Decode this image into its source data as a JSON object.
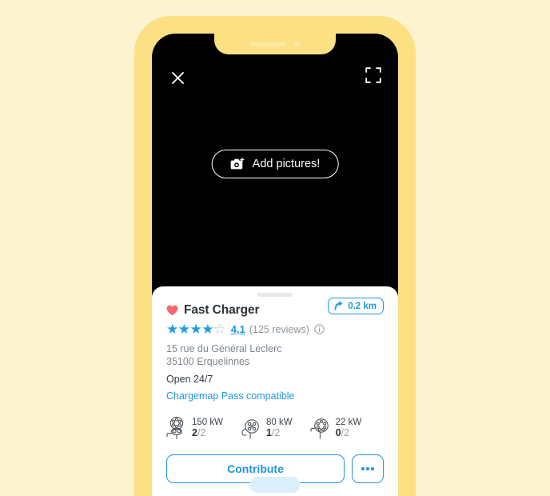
{
  "phone": {
    "notch": {
      "speaker_name": "earpiece-speaker",
      "camera_name": "front-camera"
    }
  },
  "hero": {
    "close_icon": "close-icon",
    "expand_icon": "fullscreen-icon",
    "add_pictures_label": "Add pictures!",
    "camera_icon": "camera-plus-icon"
  },
  "station": {
    "favorite_icon": "heart-icon",
    "name": "Fast Charger",
    "distance": "0.2 km",
    "direction_icon": "direction-arrow-icon",
    "rating_value": "4,1",
    "rating_stars_filled": 4,
    "rating_stars_total": 5,
    "reviews_label": "(125 reviews)",
    "info_icon": "info-icon",
    "address_line1": "15 rue du Général Leclerc",
    "address_line2": "35100 Erquelinnes",
    "hours": "Open 24/7",
    "pass_label": "Chargemap Pass compatible"
  },
  "connectors": [
    {
      "icon": "ccs-combo-connector-icon",
      "power": "150 kW",
      "available": "2",
      "total": "/2"
    },
    {
      "icon": "chademo-connector-icon",
      "power": "80 kW",
      "available": "1",
      "total": "/2"
    },
    {
      "icon": "type2-connector-icon",
      "power": "22 kW",
      "available": "0",
      "total": "/2"
    }
  ],
  "actions": {
    "contribute_label": "Contribute",
    "more_icon": "more-options-icon"
  },
  "colors": {
    "page_background": "#fdf3d0",
    "phone_frame": "#fbe184",
    "screen_background": "#000000",
    "accent_blue": "#2196dd",
    "heart_red": "#f4676e",
    "star_blue": "#1f9ce4",
    "muted_text": "#7e868d",
    "dark_text": "#2b3238"
  }
}
